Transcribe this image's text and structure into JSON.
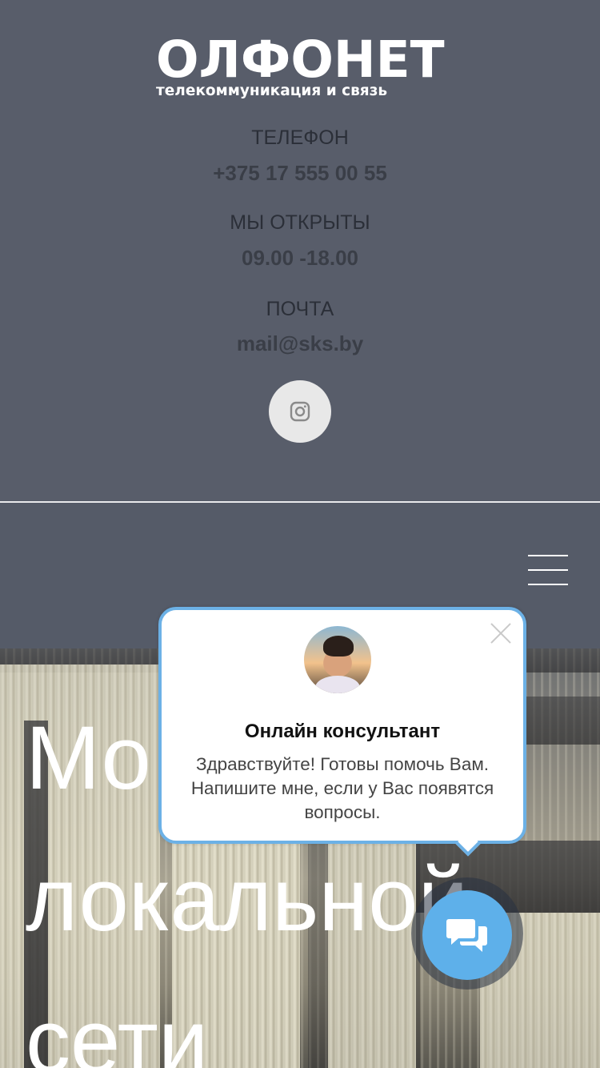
{
  "brand": {
    "name": "ОЛФОНЕТ",
    "tagline": "телекоммуникация и связь"
  },
  "contacts": {
    "phone_label": "ТЕЛЕФОН",
    "phone_value": "+375 17 555 00 55",
    "hours_label": "МЫ ОТКРЫТЫ",
    "hours_value": "09.00 -18.00",
    "mail_label": "ПОЧТА",
    "mail_value": "mail@sks.by"
  },
  "social": {
    "icon": "instagram-icon"
  },
  "nav": {
    "menu_icon": "hamburger-menu-icon"
  },
  "hero": {
    "line1": "Мо",
    "line2": "локальной",
    "line3": "сети"
  },
  "chat": {
    "title": "Онлайн консультант",
    "message": "Здравствуйте! Готовы помочь Вам. Напишите мне, если у Вас появятся вопросы.",
    "button_icon": "chat-bubbles-icon",
    "accent_color": "#5eb0ea"
  },
  "colors": {
    "header_bg": "#585d6a",
    "text_dark": "#2b2f38"
  }
}
